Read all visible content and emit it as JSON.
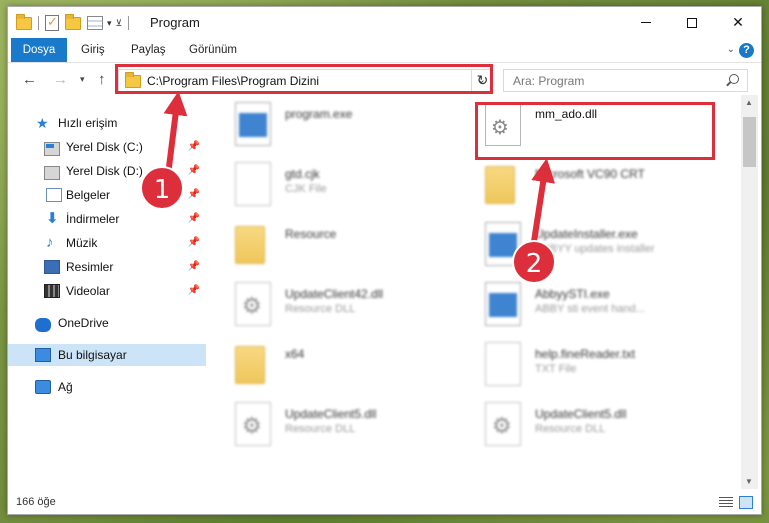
{
  "window": {
    "title": "Program"
  },
  "ribbon": {
    "tabs": [
      "Dosya",
      "Giriş",
      "Paylaş",
      "Görünüm"
    ]
  },
  "address": {
    "path": "C:\\Program Files\\Program Dizini"
  },
  "search": {
    "placeholder": "Ara: Program"
  },
  "sidebar": {
    "items": [
      {
        "label": "Hızlı erişim",
        "icon": "star-icon"
      },
      {
        "label": "Yerel Disk (C:)",
        "icon": "drive-icon",
        "pinned": true
      },
      {
        "label": "Yerel Disk (D:)",
        "icon": "drive-icon",
        "pinned": true
      },
      {
        "label": "Belgeler",
        "icon": "documents-icon",
        "pinned": true
      },
      {
        "label": "İndirmeler",
        "icon": "downloads-icon",
        "pinned": true
      },
      {
        "label": "Müzik",
        "icon": "music-icon",
        "pinned": true
      },
      {
        "label": "Resimler",
        "icon": "pictures-icon",
        "pinned": true
      },
      {
        "label": "Videolar",
        "icon": "videos-icon",
        "pinned": true
      },
      {
        "label": "OneDrive",
        "icon": "cloud-icon"
      },
      {
        "label": "Bu bilgisayar",
        "icon": "computer-icon",
        "selected": true
      },
      {
        "label": "Ağ",
        "icon": "network-icon"
      }
    ]
  },
  "files": [
    {
      "name": "program.exe",
      "sub": "",
      "icon": "exe-icon"
    },
    {
      "name": "mm_ado.dll",
      "sub": "",
      "icon": "dll-icon"
    },
    {
      "name": "gtd.cjk",
      "sub": "CJK File",
      "icon": "file-icon"
    },
    {
      "name": "Microsoft VC90 CRT",
      "sub": "",
      "icon": "folder-icon"
    },
    {
      "name": "Resource",
      "sub": "",
      "icon": "folder-icon"
    },
    {
      "name": "UpdateInstaller.exe",
      "sub": "ABBYY updates installer",
      "icon": "exe-icon"
    },
    {
      "name": "UpdateClient42.dll",
      "sub": "Resource DLL",
      "icon": "dll-icon"
    },
    {
      "name": "AbbyySTI.exe",
      "sub": "ABBY sti event hand...",
      "icon": "exe-icon"
    },
    {
      "name": "x64",
      "sub": "",
      "icon": "folder-icon"
    },
    {
      "name": "help.fineReader.txt",
      "sub": "TXT File",
      "icon": "file-icon"
    },
    {
      "name": "UpdateClient5.dll",
      "sub": "Resource DLL",
      "icon": "dll-icon"
    },
    {
      "name": "UpdateClient5.dll",
      "sub": "Resource DLL",
      "icon": "dll-icon"
    }
  ],
  "status": {
    "count": "166 öğe"
  },
  "annotations": {
    "badge1": "1",
    "badge2": "2",
    "color": "#dc2e3b"
  },
  "colors": {
    "accent": "#1979ca",
    "selection": "#cce4f7"
  }
}
